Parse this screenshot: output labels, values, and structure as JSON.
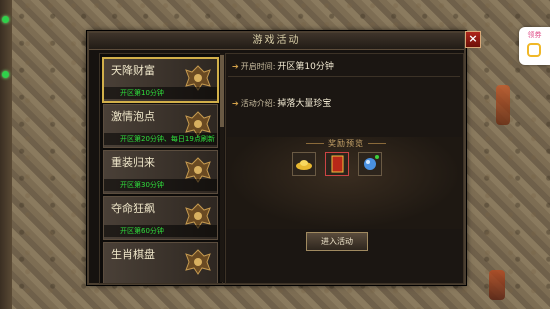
{
  "window": {
    "title": "游戏活动",
    "close_label": "×"
  },
  "activities": [
    {
      "name": "天降财富",
      "info": "开区第10分钟",
      "selected": true
    },
    {
      "name": "激情泡点",
      "info": "开区第20分钟、每日19点刷新",
      "selected": false
    },
    {
      "name": "重装归来",
      "info": "开区第30分钟",
      "selected": false
    },
    {
      "name": "夺命狂飙",
      "info": "开区第60分钟",
      "selected": false
    },
    {
      "name": "生肖棋盘",
      "info": "",
      "selected": false
    }
  ],
  "detail": {
    "open_time_label": "开启时间:",
    "open_time_value": "开区第10分钟",
    "intro_label": "活动介绍:",
    "intro_value": "掉落大量珍宝",
    "reward_title": "奖励预览",
    "rewards": [
      "gold-ingot-icon",
      "red-book-icon",
      "blue-orb-icon"
    ],
    "enter_button": "进入活动"
  },
  "side_badge": {
    "label": "领券"
  },
  "colors": {
    "accent_gold": "#d2b04a",
    "info_green": "#2fe03c",
    "close_red": "#b0261c"
  }
}
